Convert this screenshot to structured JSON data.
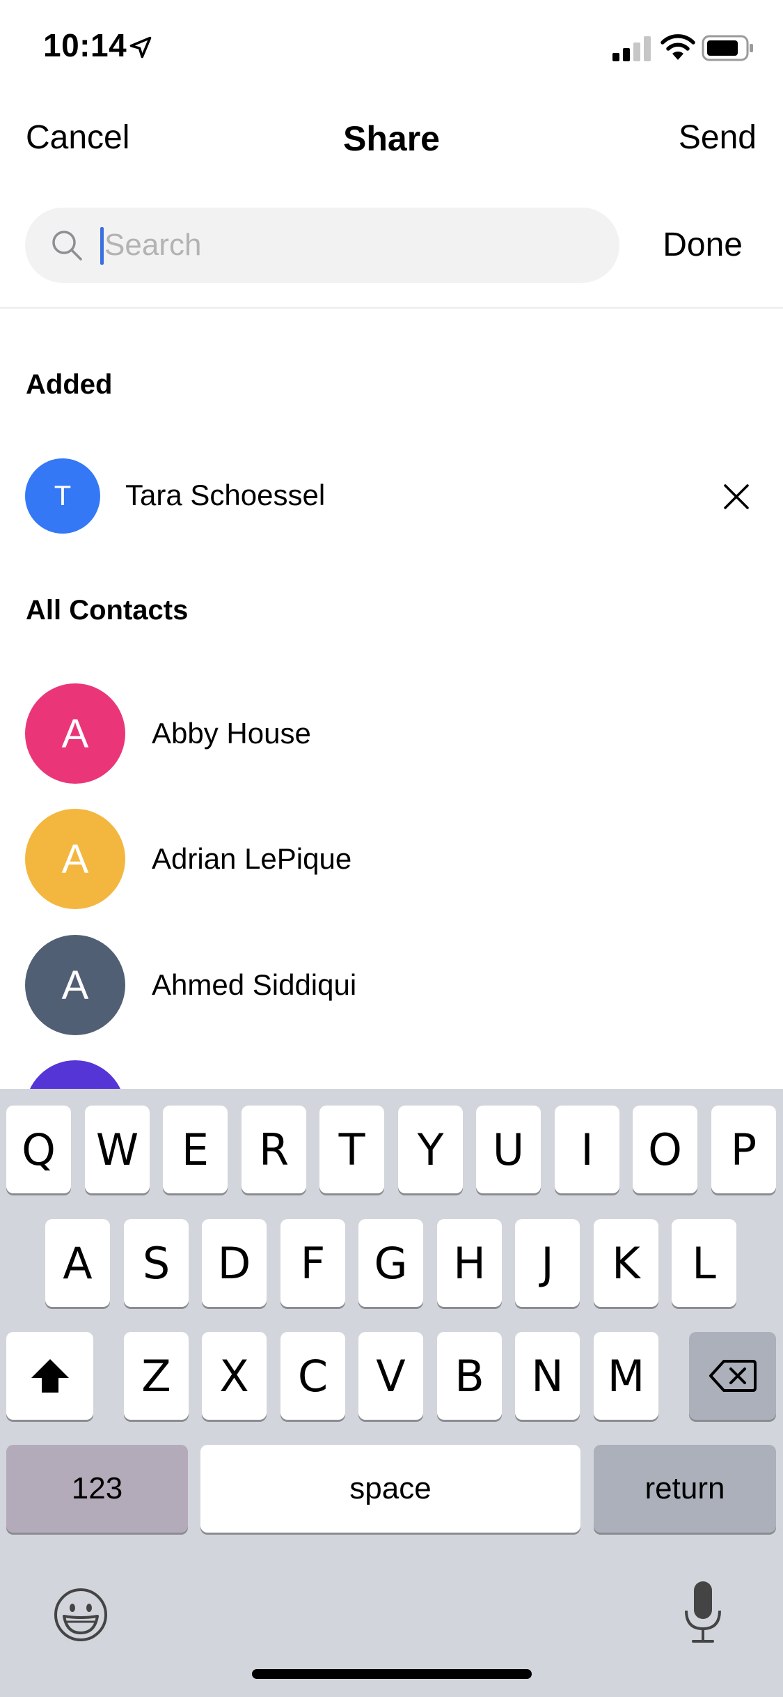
{
  "status_bar": {
    "time": "10:14"
  },
  "nav": {
    "cancel_label": "Cancel",
    "title": "Share",
    "send_label": "Send"
  },
  "search": {
    "placeholder": "Search",
    "value": "",
    "done_label": "Done"
  },
  "sections": {
    "added_title": "Added",
    "all_contacts_title": "All Contacts"
  },
  "added": [
    {
      "initial": "T",
      "name": "Tara Schoessel",
      "color": "#3478f6"
    }
  ],
  "contacts": [
    {
      "initial": "A",
      "name": "Abby House",
      "color": "#ea3679"
    },
    {
      "initial": "A",
      "name": "Adrian LePique",
      "color": "#f3b73f"
    },
    {
      "initial": "A",
      "name": "Ahmed Siddiqui",
      "color": "#515f75"
    }
  ],
  "partial_contact": {
    "color": "#5535d6"
  },
  "keyboard": {
    "row1": [
      "Q",
      "W",
      "E",
      "R",
      "T",
      "Y",
      "U",
      "I",
      "O",
      "P"
    ],
    "row2": [
      "A",
      "S",
      "D",
      "F",
      "G",
      "H",
      "J",
      "K",
      "L"
    ],
    "row3": [
      "Z",
      "X",
      "C",
      "V",
      "B",
      "N",
      "M"
    ],
    "numbers_label": "123",
    "space_label": "space",
    "return_label": "return"
  },
  "icons": {
    "location": "location-arrow-icon",
    "signal": "cellular-signal-icon",
    "wifi": "wifi-icon",
    "battery": "battery-icon",
    "search": "search-icon",
    "remove": "close-icon",
    "shift": "shift-icon",
    "delete": "backspace-icon",
    "emoji": "emoji-icon",
    "mic": "microphone-icon"
  },
  "colors": {
    "caret": "#3b6fe0",
    "keyboard_bg": "#d3d5dc"
  }
}
